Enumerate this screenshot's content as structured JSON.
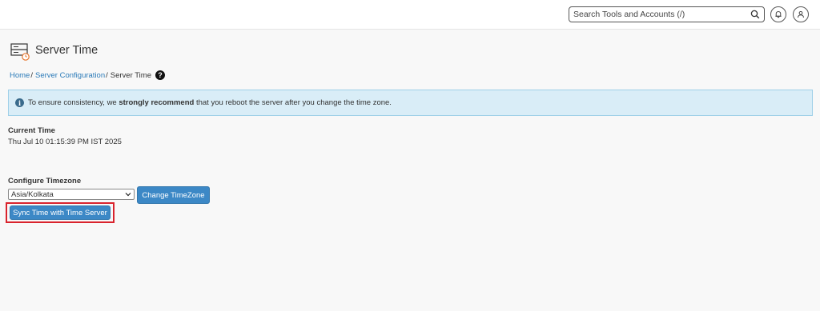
{
  "header": {
    "search_placeholder": "Search Tools and Accounts (/)",
    "icons": [
      "search-icon",
      "bell-icon",
      "user-icon"
    ]
  },
  "page": {
    "title": "Server Time",
    "icon": "server-clock-icon"
  },
  "breadcrumb": {
    "home": "Home",
    "server_configuration": "Server Configuration",
    "separator": "/",
    "current": "Server Time",
    "help": "?"
  },
  "alert": {
    "icon_glyph": "i",
    "text_before": "To ensure consistency, we ",
    "text_strong": "strongly recommend",
    "text_after": " that you reboot the server after you change the time zone."
  },
  "current_time": {
    "label": "Current Time",
    "value": "Thu Jul 10 01:15:39 PM IST 2025"
  },
  "timezone": {
    "label": "Configure Timezone",
    "selected": "Asia/Kolkata",
    "change_button": "Change TimeZone",
    "sync_button": "Sync Time with Time Server"
  },
  "colors": {
    "link": "#2a7ab8",
    "button": "#3c88c6",
    "alert_bg": "#d9edf7",
    "highlight": "#d9232d"
  }
}
